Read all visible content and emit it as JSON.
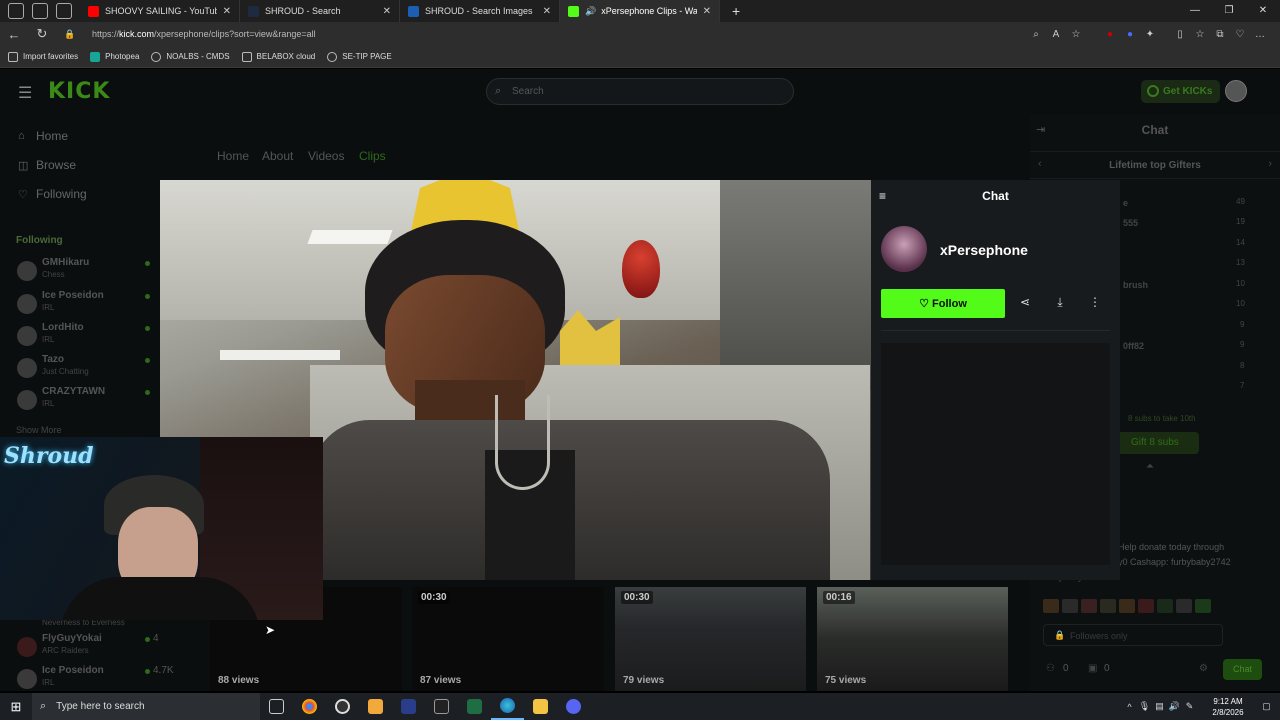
{
  "browser": {
    "tabs": [
      {
        "title": "SHOOVY SAILING - YouTube",
        "fav_color": "#ff0000"
      },
      {
        "title": "SHROUD - Search",
        "fav_color": "#1e2a40"
      },
      {
        "title": "SHROUD - Search Images",
        "fav_color": "#1a5fb4"
      },
      {
        "title": "xPersephone Clips - Watch",
        "fav_color": "#53fc18"
      }
    ],
    "new_tab": "+",
    "url_prefix": "https://",
    "url_host": "kick.com",
    "url_path": "/xpersephone/clips?sort=view&range=all",
    "favorites": [
      {
        "label": "Import favorites"
      },
      {
        "label": "Photopea"
      },
      {
        "label": "NOALBS - CMDS"
      },
      {
        "label": "BELABOX cloud"
      },
      {
        "label": "SE-TIP PAGE"
      }
    ]
  },
  "kick": {
    "logo": "KICK",
    "search_placeholder": "Search",
    "get_kicks": "Get KICKs",
    "nav": [
      {
        "label": "Home",
        "icon": "home-icon"
      },
      {
        "label": "Browse",
        "icon": "compass-icon"
      },
      {
        "label": "Following",
        "icon": "heart-icon"
      }
    ],
    "following_header": "Following",
    "following": [
      {
        "name": "GMHikaru",
        "category": "Chess"
      },
      {
        "name": "Ice Poseidon",
        "category": "IRL"
      },
      {
        "name": "LordHito",
        "category": "IRL"
      },
      {
        "name": "Tazo",
        "category": "Just Chatting"
      },
      {
        "name": "CRAZYTAWN",
        "category": "IRL"
      }
    ],
    "show_more": "Show More",
    "page_tabs": [
      "Home",
      "About",
      "Videos",
      "Clips"
    ],
    "chat_title": "Chat",
    "top_gifters_title": "Lifetime top Gifters",
    "gifters": [
      {
        "name": "e",
        "count": "49"
      },
      {
        "name": "555",
        "count": "19"
      },
      {
        "name": "",
        "count": "14"
      },
      {
        "name": "",
        "count": "13"
      },
      {
        "name": "brush",
        "count": "10"
      },
      {
        "name": "",
        "count": "10"
      },
      {
        "name": "",
        "count": "9"
      },
      {
        "name": "0ff82",
        "count": "9"
      },
      {
        "name": "",
        "count": "8"
      },
      {
        "name": "",
        "count": "7"
      }
    ],
    "subs_note": "8 subs to take 10th",
    "gift_subs": "Gift 8 subs",
    "donate_line1": "Help donate today through",
    "donate_line2": "y0 Cashapp: furbybaby2742",
    "donate_line3": "furbybaby2742",
    "followers_only": "Followers only",
    "chat_button": "Chat",
    "counter_a": "0",
    "counter_b": "0",
    "clips": [
      {
        "duration": "",
        "views": "88 views"
      },
      {
        "duration": "00:30",
        "views": "87 views"
      },
      {
        "duration": "00:30",
        "views": "79 views"
      },
      {
        "duration": "00:16",
        "views": "75 views"
      }
    ],
    "bottom_following": [
      {
        "name": "Neverness to Everness",
        "category": "",
        "viewers": ""
      },
      {
        "name": "FlyGuyYokai",
        "category": "ARC Raiders",
        "viewers": "4"
      },
      {
        "name": "Ice Poseidon",
        "category": "IRL",
        "viewers": "4.7K"
      }
    ]
  },
  "modal": {
    "chat_title": "Chat",
    "streamer": "xPersephone",
    "follow": "Follow"
  },
  "webcam": {
    "overlay_logo": "Shroud"
  },
  "taskbar": {
    "search_placeholder": "Type here to search",
    "time": "9:12 AM",
    "date": "2/8/2026"
  },
  "colors": {
    "kick_green": "#53fc18",
    "background": "#0b0e0f"
  }
}
